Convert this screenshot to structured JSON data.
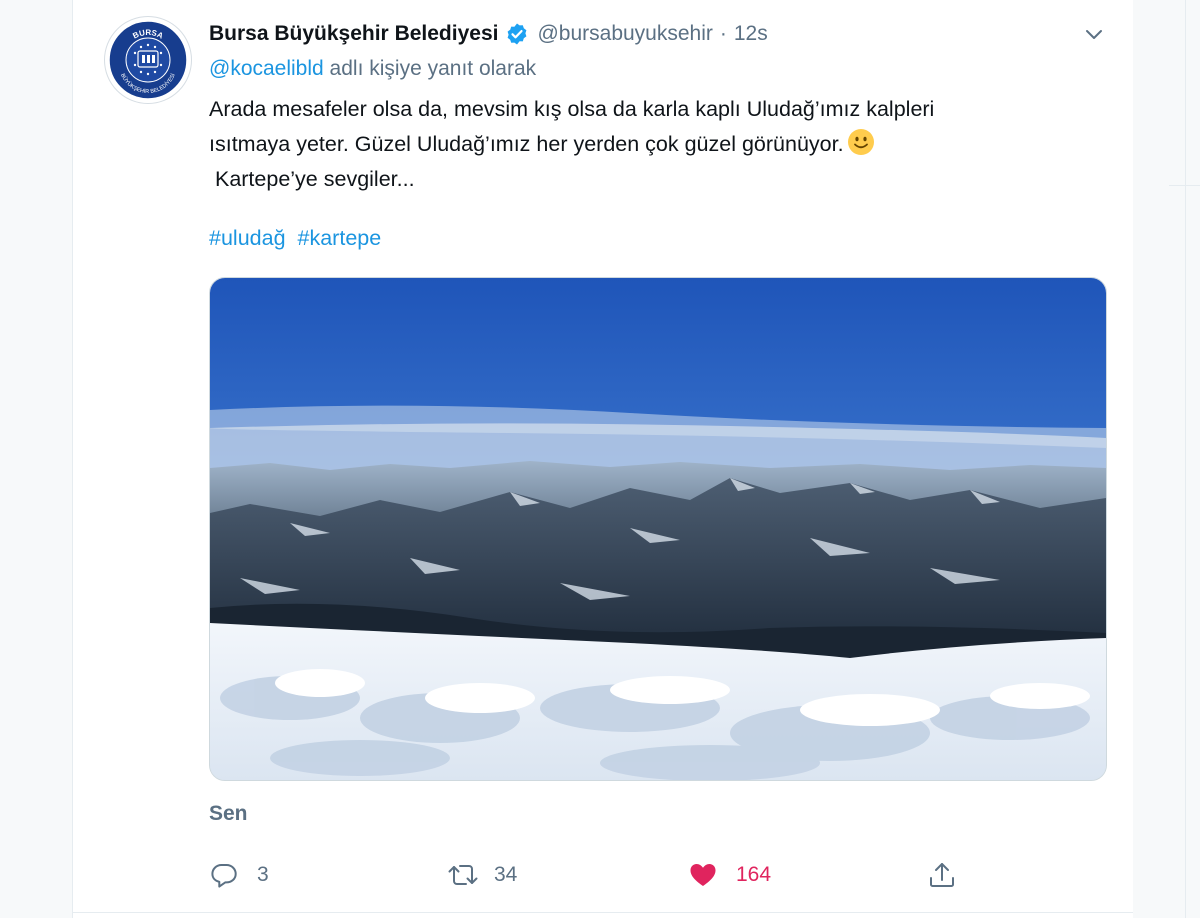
{
  "tweet": {
    "author_name": "Bursa Büyükşehir Belediyesi",
    "avatar_text_top": "BURSA",
    "avatar_text_bottom": "BÜYÜKŞEHİR BELEDİYESİ",
    "handle": "@bursabuyuksehir",
    "separator": "·",
    "time": "12s",
    "reply_to_mention": "@kocaelibld",
    "reply_to_suffix": " adlı kişiye yanıt olarak",
    "text_lines": [
      "Arada mesafeler olsa da, mevsim kış olsa da karla kaplı Uludağ’ımız kalpleri",
      "ısıtmaya yeter. Güzel Uludağ’ımız her yerden çok güzel görünüyor.",
      " Kartepe’ye sevgiler..."
    ],
    "hashtags": [
      "#uludağ",
      "#kartepe"
    ],
    "sen_label": "Sen"
  },
  "actions": {
    "reply_count": "3",
    "retweet_count": "34",
    "like_count": "164"
  },
  "icons": {
    "verified": "verified-badge-icon",
    "caret": "chevron-down-icon",
    "reply": "reply-icon",
    "retweet": "retweet-icon",
    "like": "heart-icon",
    "share": "share-icon",
    "emoji": "smiley-emoji-icon"
  },
  "colors": {
    "link": "#1b95e0",
    "secondary_text": "#5b7083",
    "like": "#e0245e",
    "avatar_blue": "#173d8e"
  }
}
